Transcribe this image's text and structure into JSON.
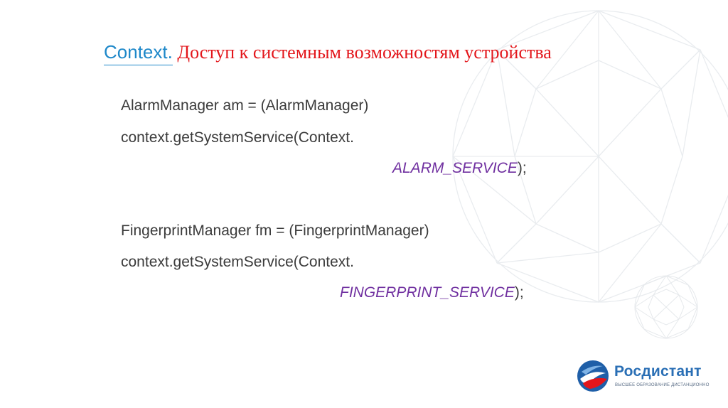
{
  "title": {
    "context": "Context.",
    "rest": " Доступ к системным возможностям устройства"
  },
  "code": {
    "alarm_line1": "AlarmManager am = (AlarmManager)",
    "alarm_line2": "context.getSystemService(Context.",
    "alarm_const": "ALARM_SERVICE",
    "alarm_suffix": ");",
    "fp_line1": "FingerprintManager fm = (FingerprintManager)",
    "fp_line2": "context.getSystemService(Context.",
    "fp_const": "FINGERPRINT_SERVICE",
    "fp_suffix": ");"
  },
  "logo": {
    "name": "Росдистант",
    "tagline": "ВЫСШЕЕ ОБРАЗОВАНИЕ ДИСТАНЦИОННО"
  },
  "colors": {
    "title_context": "#1e88c9",
    "title_rest": "#e3161b",
    "code_text": "#3b3b3b",
    "constant": "#7030a0",
    "logo_blue": "#2a6fb5"
  }
}
